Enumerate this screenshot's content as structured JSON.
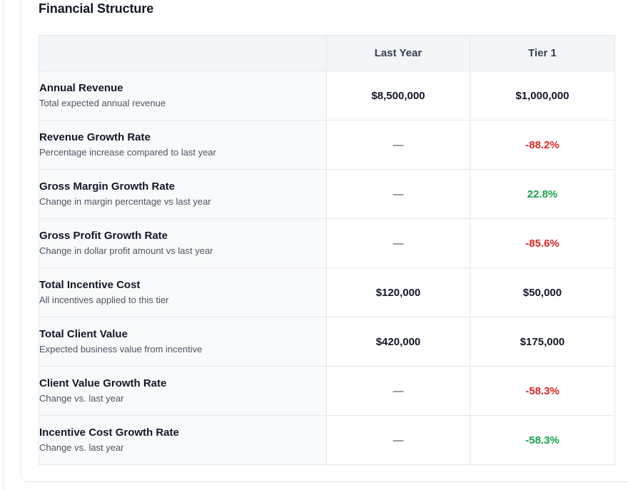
{
  "section": {
    "title": "Financial Structure"
  },
  "table": {
    "columns": [
      "",
      "Last Year",
      "Tier 1"
    ],
    "rows": [
      {
        "name": "Annual Revenue",
        "desc": "Total expected annual revenue",
        "last_year": "$8,500,000",
        "tier1": "$1,000,000",
        "tier1_tone": "neutral"
      },
      {
        "name": "Revenue Growth Rate",
        "desc": "Percentage increase compared to last year",
        "last_year": "—",
        "tier1": "-88.2%",
        "tier1_tone": "negative"
      },
      {
        "name": "Gross Margin Growth Rate",
        "desc": "Change in margin percentage vs last year",
        "last_year": "—",
        "tier1": "22.8%",
        "tier1_tone": "positive"
      },
      {
        "name": "Gross Profit Growth Rate",
        "desc": "Change in dollar profit amount vs last year",
        "last_year": "—",
        "tier1": "-85.6%",
        "tier1_tone": "negative"
      },
      {
        "name": "Total Incentive Cost",
        "desc": "All incentives applied to this tier",
        "last_year": "$120,000",
        "tier1": "$50,000",
        "tier1_tone": "neutral"
      },
      {
        "name": "Total Client Value",
        "desc": "Expected business value from incentive",
        "last_year": "$420,000",
        "tier1": "$175,000",
        "tier1_tone": "neutral"
      },
      {
        "name": "Client Value Growth Rate",
        "desc": "Change vs. last year",
        "last_year": "—",
        "tier1": "-58.3%",
        "tier1_tone": "negative"
      },
      {
        "name": "Incentive Cost Growth Rate",
        "desc": "Change vs. last year",
        "last_year": "—",
        "tier1": "-58.3%",
        "tier1_tone": "positive"
      }
    ]
  },
  "colors": {
    "negative": "#dc2626",
    "positive": "#16a34a",
    "header_bg": "#f3f6f9",
    "label_bg": "#f9fafb",
    "border": "#e5e7eb"
  }
}
